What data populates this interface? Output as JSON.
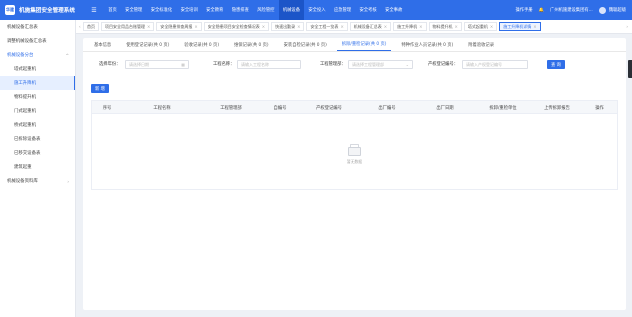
{
  "app": {
    "logo_text": "华建",
    "title": "机施集团安全管理系统",
    "menu_icon": "hamburger-icon"
  },
  "topnav": [
    "首页",
    "安全管理",
    "安全标准化",
    "安全培训",
    "安全教育",
    "隐患排查",
    "风险管控",
    "机械设备",
    "安全投入",
    "应急管理",
    "安全考核",
    "安全事故"
  ],
  "topnav_active_index": 7,
  "top_right": {
    "manual": "操作手册",
    "company": "广州机施建设集团有...",
    "user": "魏聪超级"
  },
  "sidebar": [
    {
      "label": "机械设备汇总表",
      "type": "item"
    },
    {
      "label": "调整机械设备汇总表",
      "type": "item"
    },
    {
      "label": "机械设备分台",
      "type": "group-open"
    },
    {
      "label": "塔式起重机",
      "type": "sub"
    },
    {
      "label": "施工升降机",
      "type": "sub-active"
    },
    {
      "label": "物料提升机",
      "type": "sub"
    },
    {
      "label": "门式起重机",
      "type": "sub"
    },
    {
      "label": "桥式起重机",
      "type": "sub"
    },
    {
      "label": "已拆除设备表",
      "type": "sub"
    },
    {
      "label": "已移交设备表",
      "type": "sub"
    },
    {
      "label": "建筑起重",
      "type": "sub"
    },
    {
      "label": "机械设备资料库",
      "type": "group"
    }
  ],
  "tabs": [
    "首页",
    "项目安全用品台账管理",
    "安全隐患排查周报",
    "安全隐患项目安全检查情况表",
    "快速出勤录",
    "安全工程一览表",
    "机械设备汇总表",
    "施工升降机",
    "物料提升机",
    "塔式起重机",
    "施工升降机详情"
  ],
  "tabs_active_index": 10,
  "subtabs": [
    "基本信息",
    "使用登记记录(共 0 页)",
    "验收记录(共 0 页)",
    "维保记录(共 0 页)",
    "安装自检记录(共 0 页)",
    "拆除/重检记录(共 0 页)",
    "特种作业人员记录(共 0 页)",
    "附着验收记录"
  ],
  "subtabs_active_index": 5,
  "filters": {
    "choose_year_label": "选择年份：",
    "choose_year_placeholder": "请选择日期",
    "project_name_label": "工程名称：",
    "project_name_placeholder": "请输入工程名称",
    "project_manager_label": "工程管理部：",
    "project_manager_placeholder": "请选择工程管理部",
    "property_reg_label": "产权登记编号：",
    "property_reg_placeholder": "请输入产权登记编号",
    "search_button": "查 询"
  },
  "add_button": "新 增",
  "table": {
    "columns": [
      "序号",
      "工程名称",
      "工程管理部",
      "自编号",
      "产权登记编号",
      "出厂编号",
      "出厂日期",
      "拆卸/重检单位",
      "上传拆卸报告",
      "操作"
    ],
    "empty_text": "暂无数据"
  }
}
